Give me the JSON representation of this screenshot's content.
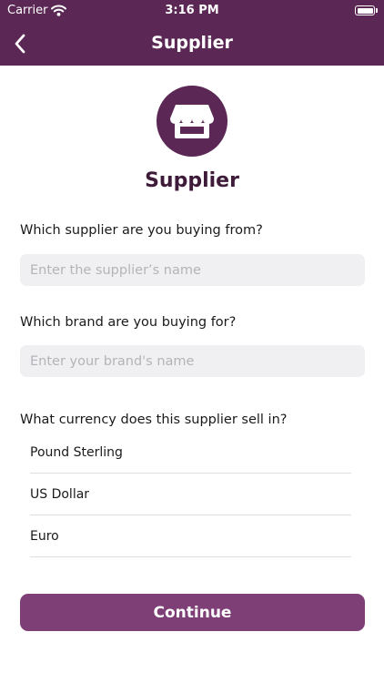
{
  "status_bar": {
    "carrier": "Carrier",
    "time": "3:16 PM"
  },
  "header": {
    "title": "Supplier",
    "back_icon": "chevron-left-icon"
  },
  "hero": {
    "icon": "storefront-icon",
    "title": "Supplier"
  },
  "form": {
    "supplier": {
      "question": "Which supplier are you buying from?",
      "value": "",
      "placeholder": "Enter the supplier’s name"
    },
    "brand": {
      "question": "Which brand are you buying for?",
      "value": "",
      "placeholder": "Enter your brand's name"
    },
    "currency": {
      "question": "What currency does this supplier sell in?",
      "options": [
        "Pound Sterling",
        "US Dollar",
        "Euro"
      ]
    }
  },
  "actions": {
    "continue_label": "Continue"
  },
  "colors": {
    "primary": "#5b2754",
    "button": "#7d3f76",
    "title_text": "#3f1b3a",
    "input_bg": "#f0f0f2"
  }
}
